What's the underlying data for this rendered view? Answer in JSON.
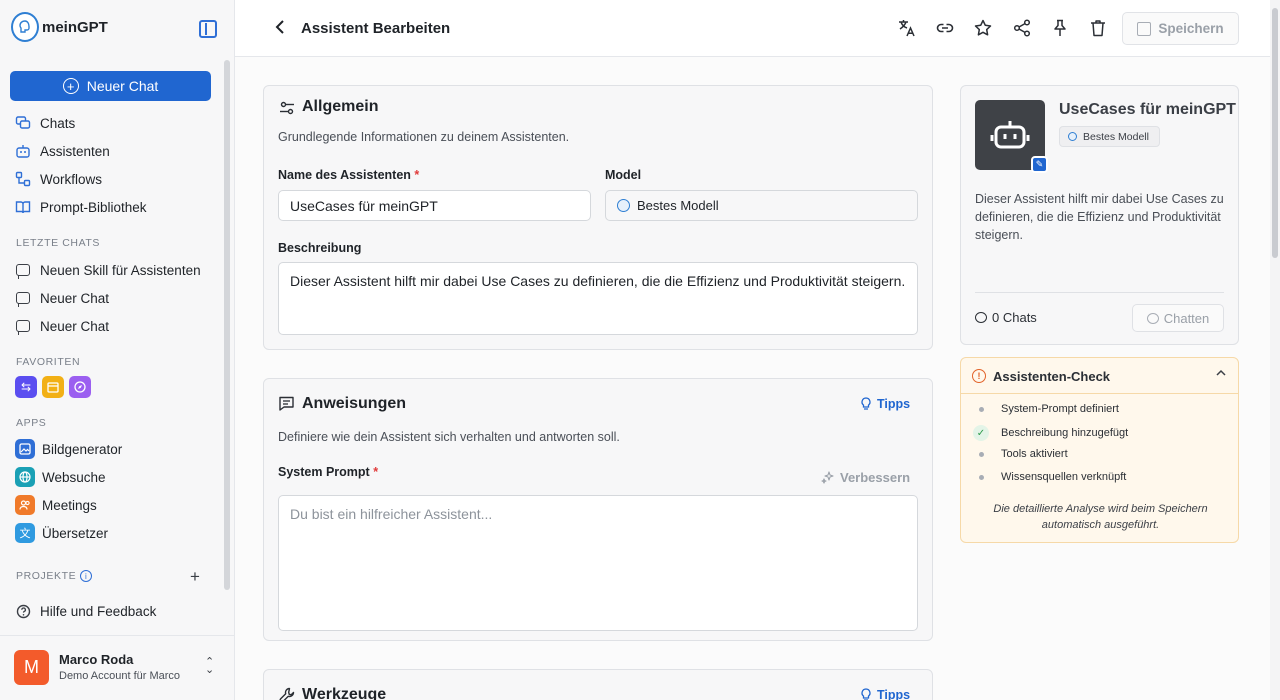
{
  "sidebar": {
    "logo_text": "meinGPT",
    "new_chat_label": "Neuer Chat",
    "nav": [
      {
        "label": "Chats",
        "icon": "chats-icon"
      },
      {
        "label": "Assistenten",
        "icon": "robot-icon"
      },
      {
        "label": "Workflows",
        "icon": "workflow-icon"
      },
      {
        "label": "Prompt-Bibliothek",
        "icon": "book-icon"
      }
    ],
    "recent_title": "LETZTE CHATS",
    "recent": [
      {
        "label": "Neuen Skill für Assistenten"
      },
      {
        "label": "Neuer Chat"
      },
      {
        "label": "Neuer Chat"
      }
    ],
    "favorites_title": "FAVORITEN",
    "favorites": [
      {
        "icon": "swap-arrows-icon",
        "color": "#5b4ef0",
        "glyph": "⇆"
      },
      {
        "icon": "calendar-icon",
        "color": "#f2b015",
        "glyph": "▦"
      },
      {
        "icon": "compass-icon",
        "color": "#9b5ff0",
        "glyph": "◎"
      }
    ],
    "apps_title": "APPS",
    "apps": [
      {
        "label": "Bildgenerator",
        "icon": "image-icon",
        "color": "#2f6fd6",
        "glyph": "▣"
      },
      {
        "label": "Websuche",
        "icon": "globe-icon",
        "color": "#1aa0b5",
        "glyph": "◍"
      },
      {
        "label": "Meetings",
        "icon": "users-icon",
        "color": "#f07a2a",
        "glyph": "☺"
      },
      {
        "label": "Übersetzer",
        "icon": "translate-icon",
        "color": "#2f9ae0",
        "glyph": "文"
      }
    ],
    "projects_title": "PROJEKTE",
    "help_label": "Hilfe und Feedback",
    "user": {
      "initial": "M",
      "name": "Marco Roda",
      "account": "Demo Account für Marco"
    }
  },
  "header": {
    "title": "Assistent Bearbeiten",
    "save_label": "Speichern"
  },
  "allgemein": {
    "title": "Allgemein",
    "subtitle": "Grundlegende Informationen zu deinem Assistenten.",
    "name_label": "Name des Assistenten",
    "required_mark": "*",
    "name_value": "UseCases für meinGPT",
    "model_label": "Model",
    "model_value": "Bestes Modell",
    "desc_label": "Beschreibung",
    "desc_value": "Dieser Assistent hilft mir dabei Use Cases zu definieren, die die Effizienz und Produktivität steigern."
  },
  "anweisungen": {
    "title": "Anweisungen",
    "tipps_label": "Tipps",
    "subtitle": "Definiere wie dein Assistent sich verhalten und antworten soll.",
    "prompt_label": "System Prompt",
    "required_mark": "*",
    "improve_label": "Verbessern",
    "prompt_placeholder": "Du bist ein hilfreicher Assistent..."
  },
  "werkzeuge": {
    "title": "Werkzeuge",
    "tipps_label": "Tipps"
  },
  "preview": {
    "title": "UseCases für meinGPT",
    "badge": "Bestes Modell",
    "description": "Dieser Assistent hilft mir dabei Use Cases zu definieren, die die Effizienz und Produk­tivität steigern.",
    "chat_count": "0 Chats",
    "chat_button": "Chatten"
  },
  "check": {
    "title": "Assistenten-Check",
    "items": [
      {
        "label": "System-Prompt definiert",
        "done": false
      },
      {
        "label": "Beschreibung hinzugefügt",
        "done": true
      },
      {
        "label": "Tools aktiviert",
        "done": false
      },
      {
        "label": "Wissensquellen verknüpft",
        "done": false
      }
    ],
    "note": "Die detaillierte Analyse wird beim Speichern automatisch ausgeführt."
  }
}
